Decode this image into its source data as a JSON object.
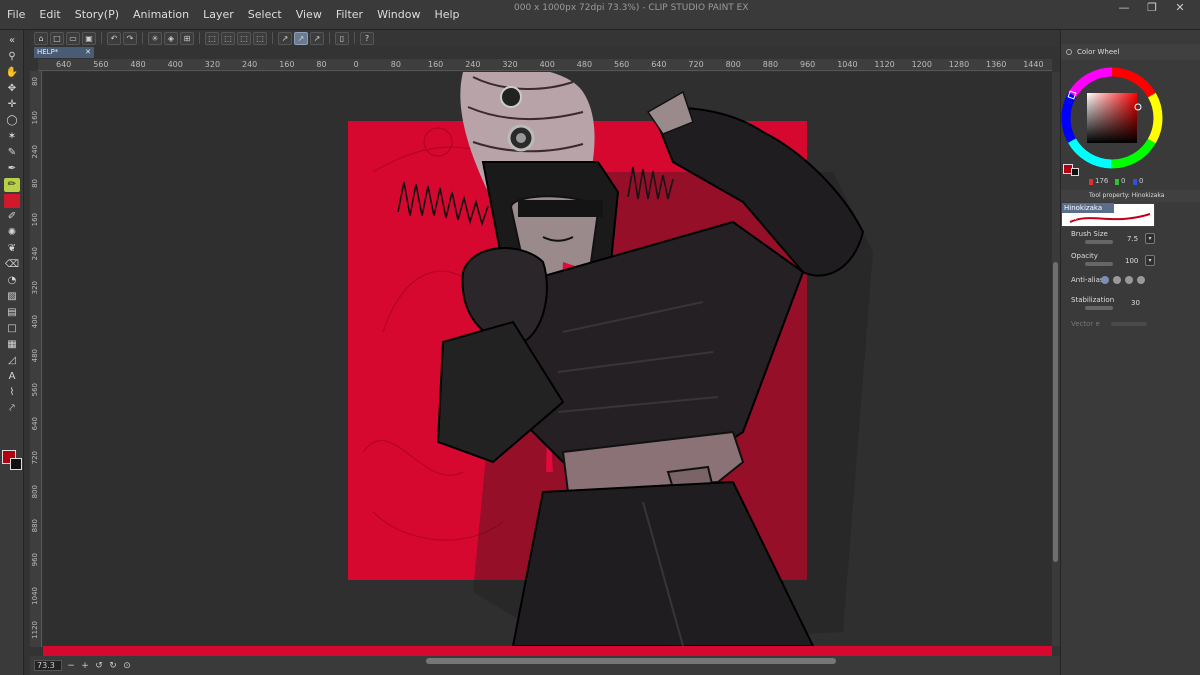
{
  "window": {
    "title": "000 x 1000px 72dpi 73.3%) - CLIP STUDIO PAINT EX",
    "controls": [
      "—",
      "❐",
      "✕"
    ]
  },
  "menubar": {
    "items": [
      "File",
      "Edit",
      "Story(P)",
      "Animation",
      "Layer",
      "Select",
      "View",
      "Filter",
      "Window",
      "Help"
    ]
  },
  "document": {
    "tab_label": "HELP*",
    "tab_close": "✕"
  },
  "ruler_top": [
    "640",
    "560",
    "480",
    "400",
    "320",
    "240",
    "160",
    "80",
    "0",
    "80",
    "160",
    "240",
    "320",
    "400",
    "480",
    "560",
    "640",
    "720",
    "800",
    "880",
    "960",
    "1040",
    "1120",
    "1200",
    "1280",
    "1360",
    "1440"
  ],
  "ruler_left": [
    "80",
    "160",
    "240",
    "80",
    "160",
    "240",
    "320",
    "400",
    "480",
    "560",
    "640",
    "720",
    "800",
    "880",
    "960",
    "1040",
    "1120"
  ],
  "statusbar": {
    "zoom": "73.3"
  },
  "color_panel": {
    "title": "Color Wheel",
    "values": {
      "h": "176",
      "s": "0",
      "v": "0"
    },
    "main_color": "#b00012",
    "sub_color": "#111111"
  },
  "tool_property": {
    "title": "Tool property: Hinokizaka",
    "brush_name": "Hinokizaka Pen",
    "brush_size_label": "Brush Size",
    "brush_size_value": "7.5",
    "opacity_label": "Opacity",
    "opacity_value": "100",
    "antialias_label": "Anti-alias",
    "stabilization_label": "Stabilization",
    "stabilization_value": "30",
    "vector_label": "Vector e"
  },
  "colors": {
    "accent_red": "#d6082f",
    "panel": "#3a3a3a",
    "tool_active": "#b8d04a"
  }
}
